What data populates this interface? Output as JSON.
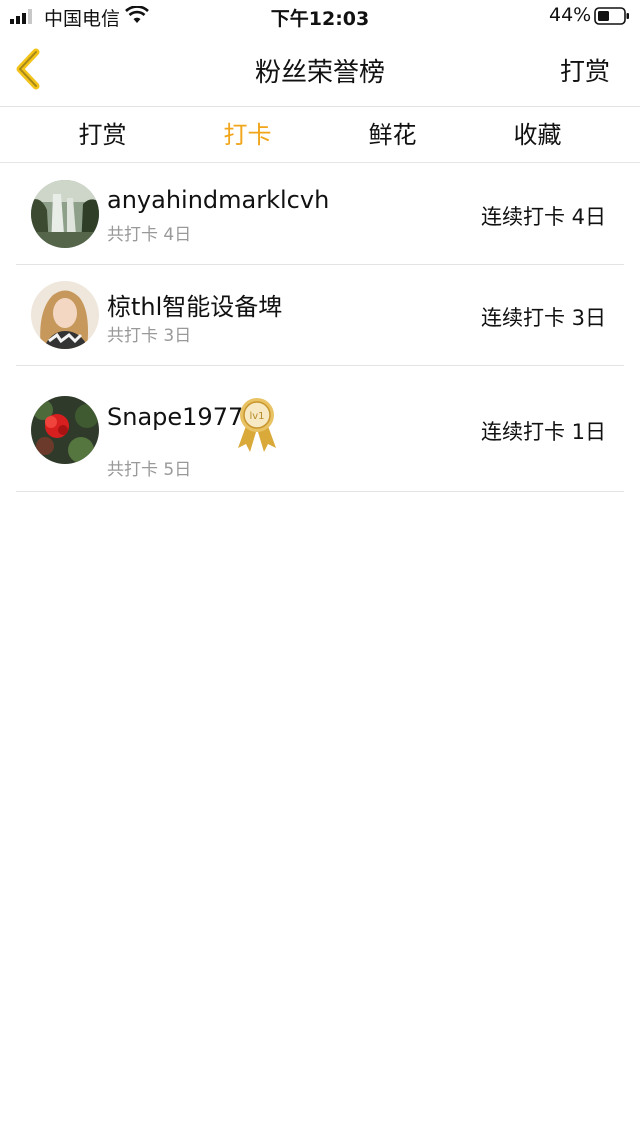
{
  "status_bar": {
    "carrier": "中国电信",
    "time": "下午12:03",
    "battery_percent": "44%",
    "signal_icon": "signal-bars-icon",
    "wifi_icon": "wifi-icon",
    "battery_icon": "battery-icon"
  },
  "nav": {
    "back_icon": "chevron-left-icon",
    "title": "粉丝荣誉榜",
    "right_label": "打赏"
  },
  "tabs": [
    {
      "label": "打赏",
      "active": false
    },
    {
      "label": "打卡",
      "active": true
    },
    {
      "label": "鲜花",
      "active": false
    },
    {
      "label": "收藏",
      "active": false
    }
  ],
  "colors": {
    "accent": "#f0a51a",
    "divider": "#e4e4e4",
    "secondary_text": "#999999"
  },
  "list": [
    {
      "name": "anyahindmarklcvh",
      "total": "共打卡 4日",
      "streak": "连续打卡 4日"
    },
    {
      "name": "椋thl智能设备埤",
      "total": "共打卡 3日",
      "streak": "连续打卡 3日"
    },
    {
      "name": "Snape1977",
      "total": "共打卡 5日",
      "streak": "连续打卡 1日",
      "badge_text": "lv1",
      "badge_icon": "rosette-badge-icon"
    }
  ]
}
